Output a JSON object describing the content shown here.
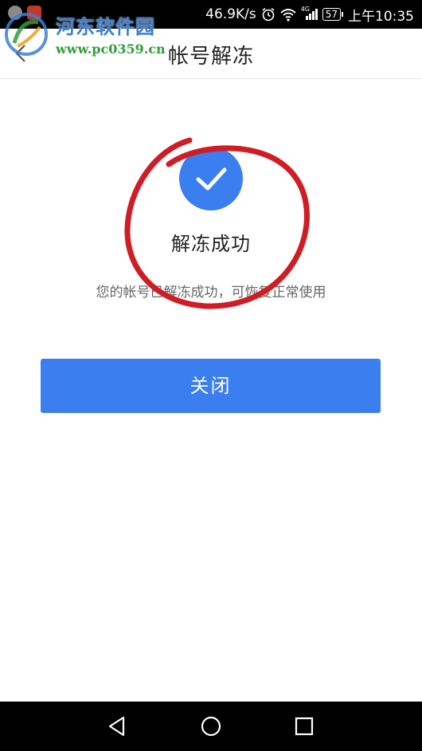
{
  "status_bar": {
    "speed": "46.9K/s",
    "network_type": "4G",
    "battery": "57",
    "time": "上午10:35",
    "icons": [
      "notification-icon",
      "weibo-icon",
      "alarm-icon",
      "wifi-icon",
      "signal-icon",
      "battery-icon"
    ]
  },
  "watermark": {
    "name": "河东软件园",
    "url": "www.pc0359.cn"
  },
  "header": {
    "title": "帐号解冻",
    "back_icon": "chevron-left-icon"
  },
  "result": {
    "icon": "check-icon",
    "title": "解冻成功",
    "description": "您的帐号已解冻成功，可恢复正常使用"
  },
  "actions": {
    "close_label": "关闭"
  },
  "nav_bar": {
    "icons": [
      "back-triangle-icon",
      "home-circle-icon",
      "recents-square-icon"
    ]
  },
  "colors": {
    "accent": "#3a7ef0",
    "annotation": "#d01c25",
    "status_bar_bg": "#000000"
  }
}
